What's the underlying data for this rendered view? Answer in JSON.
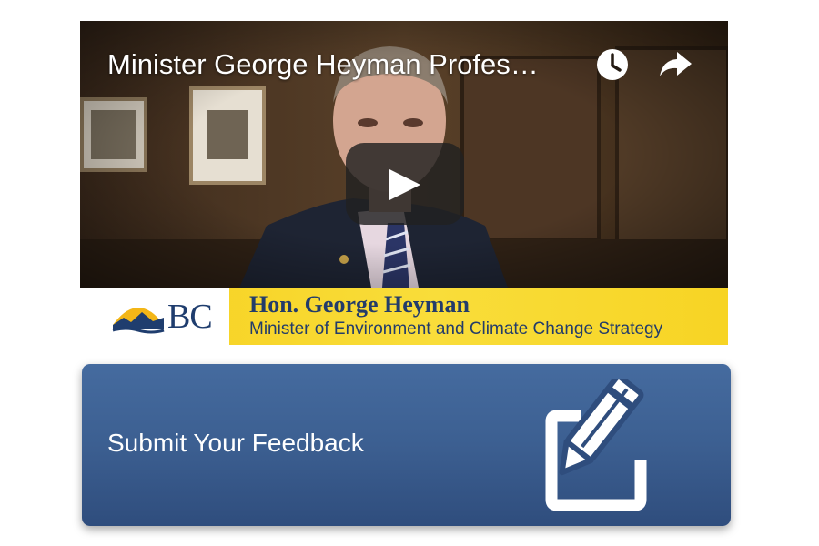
{
  "video": {
    "title": "Minister George Heyman Profes…",
    "controls": {
      "watch_later_icon": "clock-icon",
      "share_icon": "share-arrow-icon",
      "play_icon": "play-icon"
    }
  },
  "banner": {
    "logo_text": "BC",
    "name": "Hon. George Heyman",
    "role": "Minister of Environment and Climate Change Strategy",
    "colors": {
      "band": "#f6cf1d",
      "text": "#233c6a"
    }
  },
  "feedback_button": {
    "label": "Submit Your Feedback",
    "icon": "pencil-edit-icon",
    "color": "#3c5f91"
  }
}
